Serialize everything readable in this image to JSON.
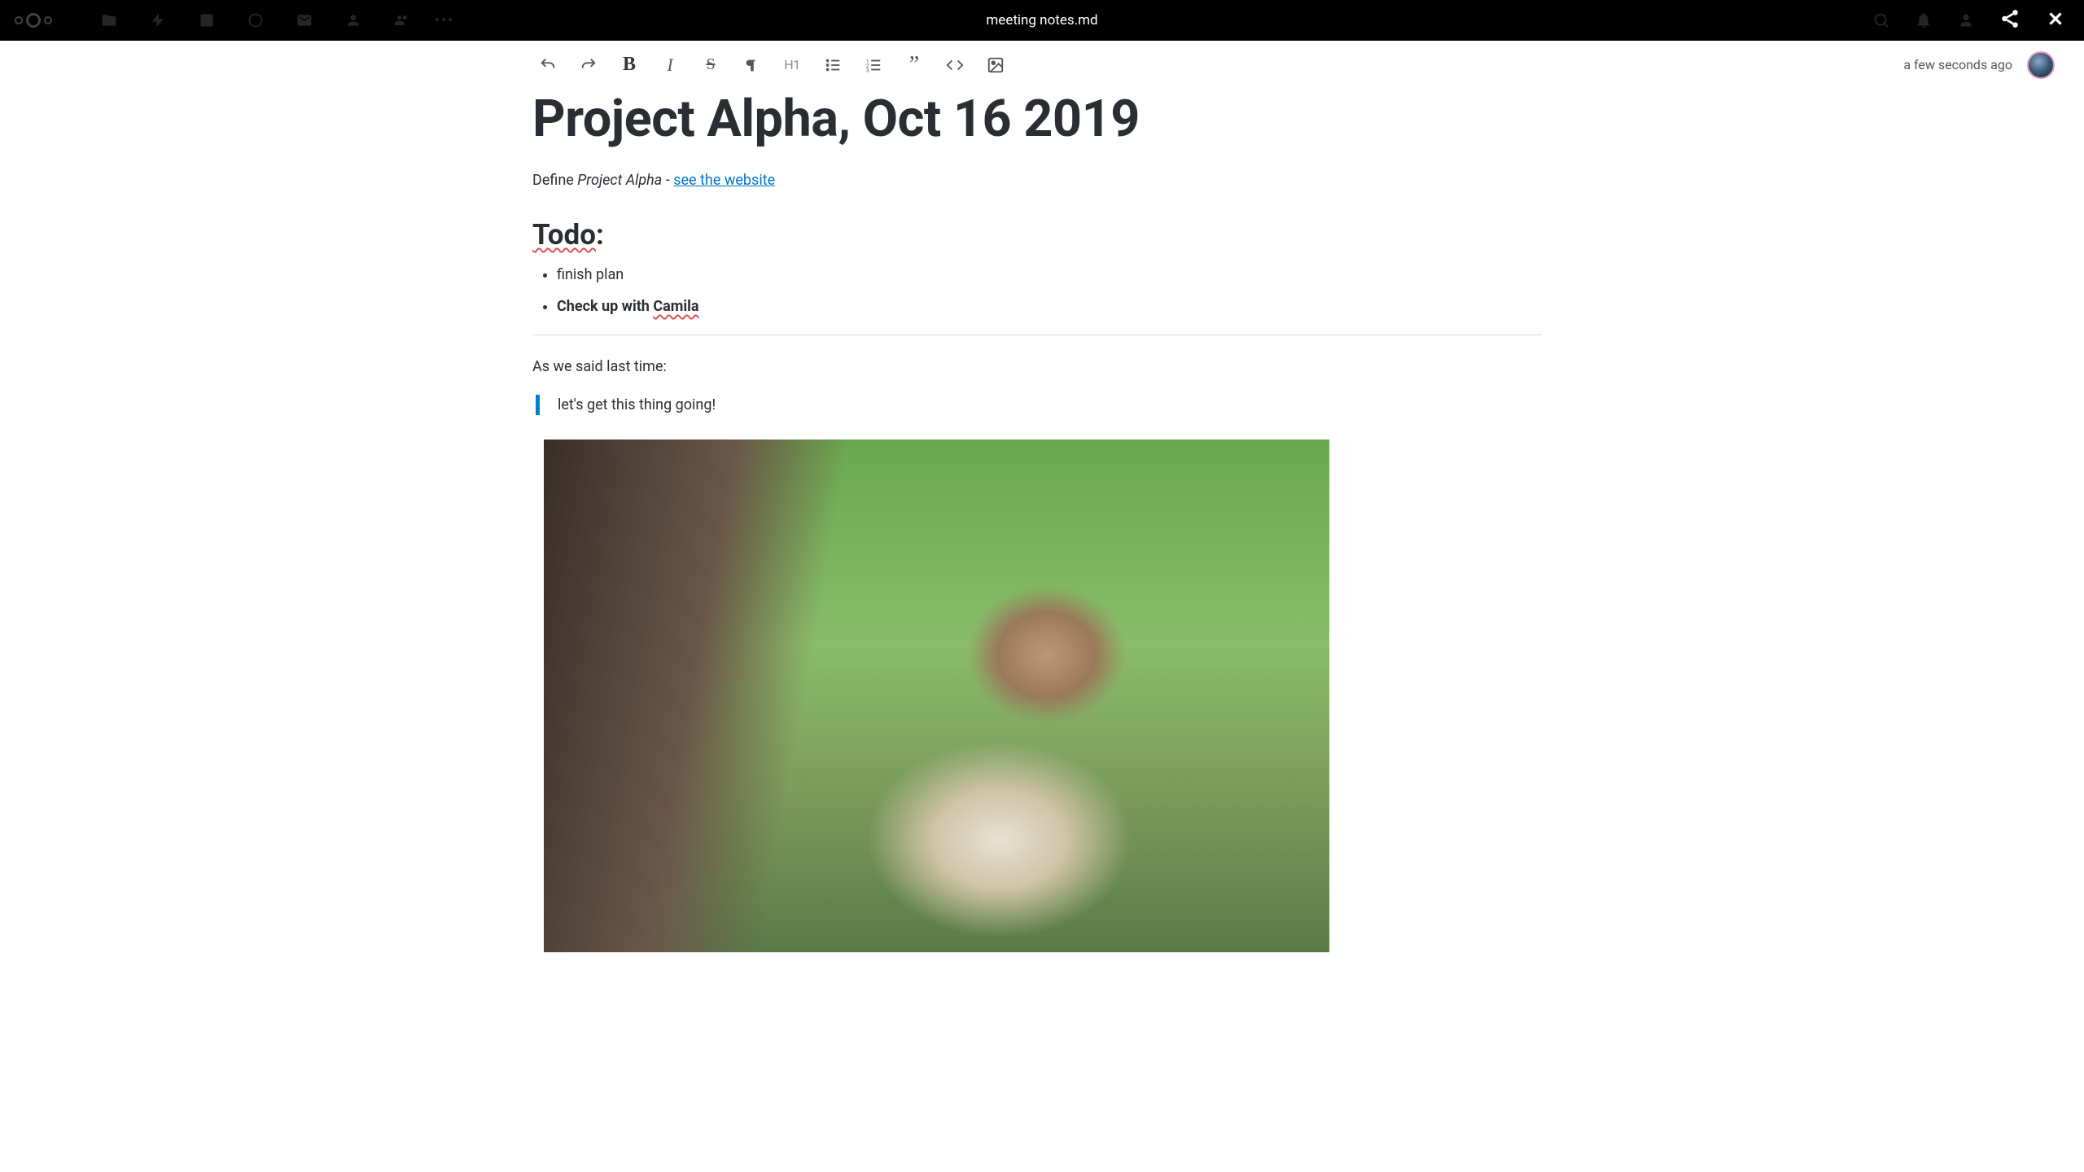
{
  "header": {
    "file_title": "meeting notes.md"
  },
  "toolbar": {
    "h1_label": "H1",
    "timestamp": "a few seconds ago"
  },
  "doc": {
    "title": "Project Alpha, Oct 16 2019",
    "line1_prefix": "Define ",
    "line1_italic": "Project Alpha",
    "line1_sep": " - ",
    "line1_link": "see the website",
    "todo_heading_word": "Todo",
    "todo_heading_suffix": ":",
    "todo_items": [
      {
        "text": "finish plan",
        "bold": false
      },
      {
        "prefix": "Check up with ",
        "spell": "Camila",
        "bold": true
      }
    ],
    "para_after_hr": "As we said last time:",
    "blockquote": "let's get this thing going!"
  }
}
